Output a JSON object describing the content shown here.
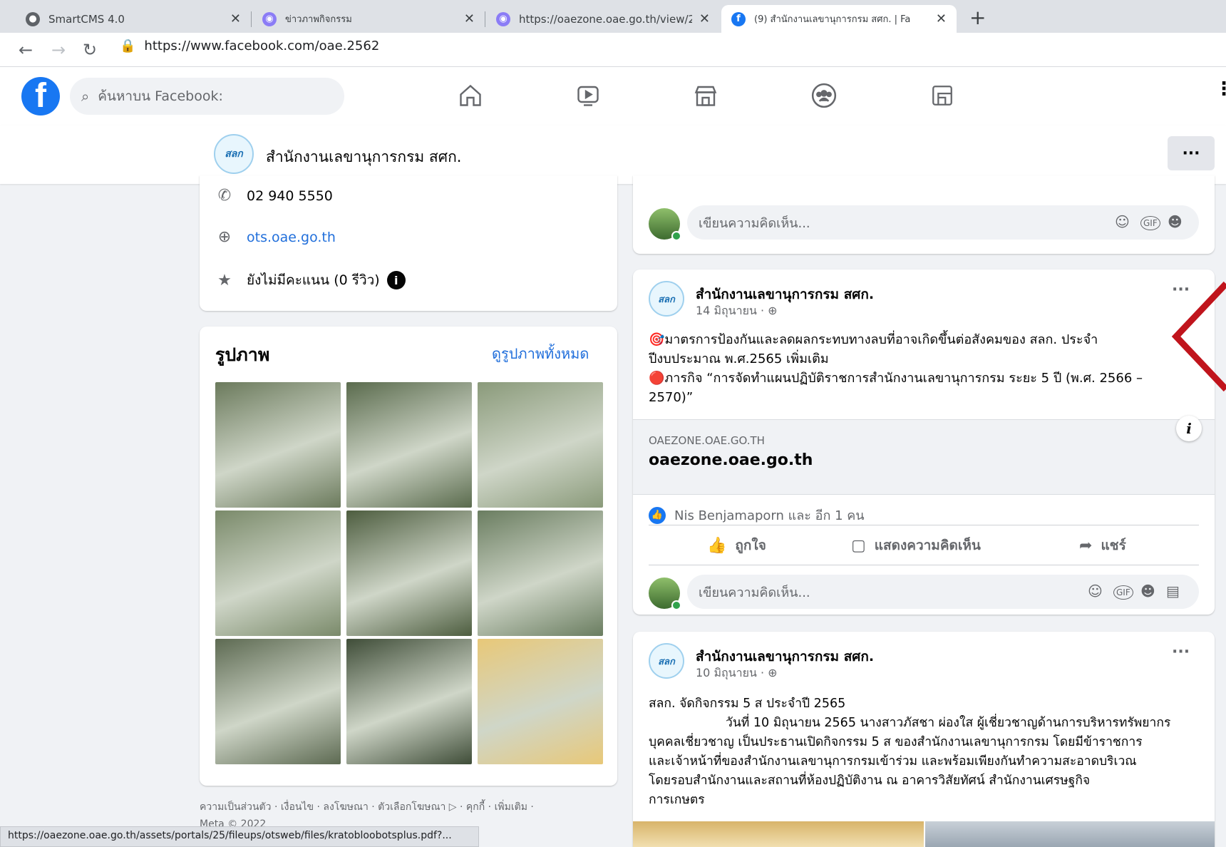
{
  "tabs": [
    {
      "title": "SmartCMS 4.0",
      "icon": "globe-icon",
      "active": false
    },
    {
      "title": "ข่าวภาพกิจกรรม",
      "icon": "site-favicon-icon",
      "active": false
    },
    {
      "title": "https://oaezone.oae.go.th/view/2",
      "icon": "site-favicon-icon",
      "active": false
    },
    {
      "title": "(9) สำนักงานเลขานุการกรม สศก. | Fa",
      "icon": "facebook-icon",
      "active": true
    }
  ],
  "address": {
    "url": "https://www.facebook.com/oae.2562"
  },
  "fb_header": {
    "search_placeholder": "ค้นหาบน Facebook:"
  },
  "page": {
    "name": "สำนักงานเลขานุการกรม สศก.",
    "logo_text": "สลก"
  },
  "info": {
    "phone": "02 940 5550",
    "website": "ots.oae.go.th",
    "rating": "ยังไม่มีคะแนน (0 รีวิว)"
  },
  "photos": {
    "title": "รูปภาพ",
    "see_all": "ดูรูปภาพทั้งหมด",
    "tiles": [
      "#6b7a5c",
      "#5a6b4d",
      "#8a9a7a",
      "#7a8a6a",
      "#4d5d3f",
      "#6a7d60",
      "#5d6a52",
      "#3f4d38",
      "#e8c878"
    ]
  },
  "footer": {
    "links": "ความเป็นส่วนตัว · เงื่อนไข · ลงโฆษณา · ตัวเลือกโฆษณา ▷ · คุกกี้ · เพิ่มเติม ·",
    "copyright": "Meta © 2022"
  },
  "actions": {
    "like": "ถูกใจ",
    "comment": "แสดงความคิดเห็น",
    "share": "แชร์"
  },
  "comment_placeholder": "เขียนความคิดเห็น...",
  "post1": {
    "author": "สำนักงานเลขานุการกรม สศก.",
    "date": "14 มิถุนายน · ",
    "line1": "🎯มาตรการป้องกันและลดผลกระทบทางลบที่อาจเกิดขึ้นต่อสังคมของ สลก. ประจำ",
    "line2": "ปีงบประมาณ พ.ศ.2565 เพิ่มเติม",
    "line3": "🔴ภารกิจ “การจัดทำแผนปฏิบัติราชการสำนักงานเลขานุการกรม ระยะ 5 ปี (พ.ศ. 2566 –",
    "line4": "2570)”",
    "link_domain": "OAEZONE.OAE.GO.TH",
    "link_title": "oaezone.oae.go.th",
    "reactions": "Nis Benjamaporn และ อีก 1 คน"
  },
  "post2": {
    "author": "สำนักงานเลขานุการกรม สศก.",
    "date": "10 มิถุนายน · ",
    "line1": "สลก. จัดกิจกรรม 5 ส ประจำปี 2565",
    "line2": "วันที่ 10 มิถุนายน 2565 นางสาวภัสชา ผ่องใส  ผู้เชี่ยวชาญด้านการบริหารทรัพยากร",
    "line3": "บุคคลเชี่ยวชาญ  เป็นประธานเปิดกิจกรรม 5 ส ของสำนักงานเลขานุการกรม โดยมีข้าราชการ",
    "line4": "และเจ้าหน้าที่ของสำนักงานเลขานุการกรมเข้าร่วม และพร้อมเพียงกันทำความสะอาดบริเวณ",
    "line5": "โดยรอบสำนักงานและสถานที่ห้องปฏิบัติงาน ณ อาคารวิสัยทัศน์ สำนักงานเศรษฐกิจ",
    "line6": "การเกษตร"
  },
  "status_url": "https://oaezone.oae.go.th/assets/portals/25/fileups/otsweb/files/kratobloobotsplus.pdf?..."
}
